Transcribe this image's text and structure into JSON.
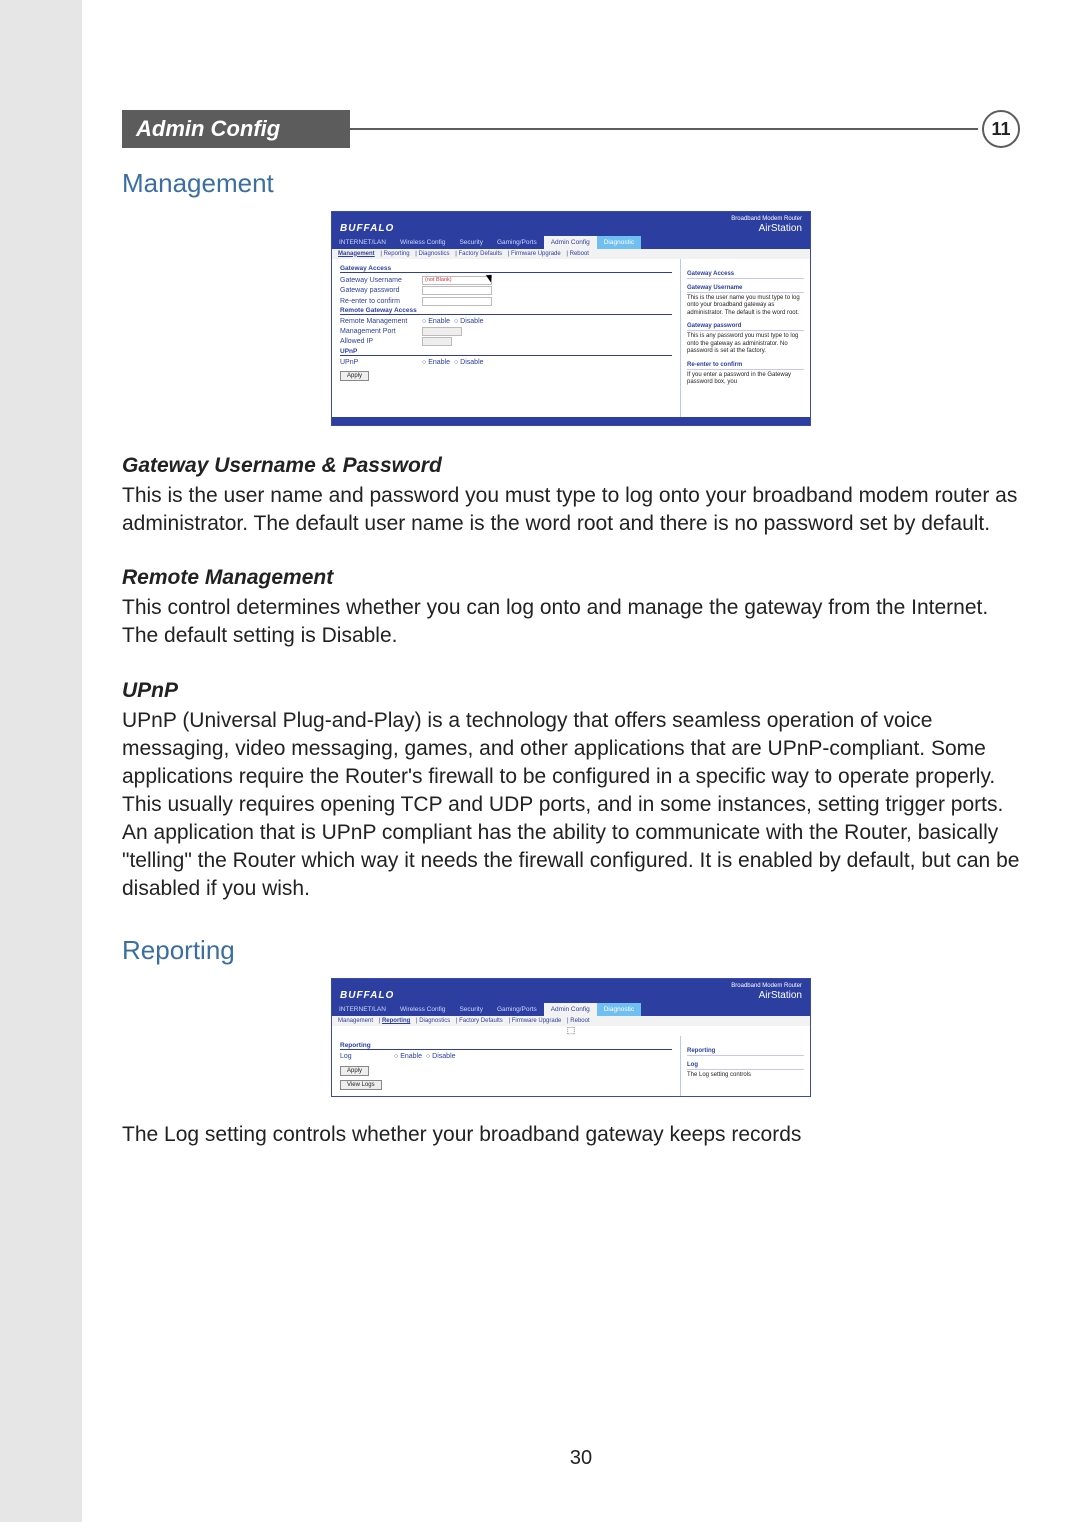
{
  "chapter": {
    "title": "Admin Config",
    "number": "11"
  },
  "sections": {
    "management": "Management",
    "reporting": "Reporting"
  },
  "gateway": {
    "heading": "Gateway Username & Password",
    "text": "This is the user name and password you must type to log onto your broadband modem router as administrator. The default user name is the word root and there is no password set by default."
  },
  "remote": {
    "heading": "Remote Management",
    "text": "This control determines whether you can log onto and manage the gateway from the Internet. The default setting is Disable."
  },
  "upnp": {
    "heading": "UPnP",
    "text": "UPnP (Universal Plug-and-Play) is a technology that offers seamless operation of voice messaging, video messaging, games, and other applications that are UPnP-compliant. Some applications require the Router's firewall to be configured in a specific way to operate properly. This usually requires opening TCP and UDP ports, and in some instances, setting trigger ports. An application that is UPnP compliant has the ability to communicate with the Router, basically \"telling\" the Router which way it needs the firewall configured. It is enabled by default, but can be disabled if you wish."
  },
  "reporting_text": "The Log setting controls whether your broadband gateway keeps records",
  "page_number": "30",
  "shot_common": {
    "brand": "BUFFALO",
    "tagline": "Broadband Modem Router",
    "airstation": "AirStation",
    "tabs": [
      "INTERNET/LAN",
      "Wireless Config",
      "Security",
      "Gaming/Ports",
      "Admin Config",
      "Diagnostic"
    ],
    "subtabs": [
      "Management",
      "Reporting",
      "Diagnostics",
      "Factory Defaults",
      "Firmware Upgrade",
      "Reboot"
    ]
  },
  "shot1": {
    "groups": {
      "gateway_access": "Gateway Access",
      "remote": "Remote Gateway Access",
      "upnp": "UPnP"
    },
    "fields": {
      "username_label": "Gateway Username",
      "username_value": "(not Blank)",
      "password_label": "Gateway password",
      "confirm_label": "Re-enter to confirm",
      "remote_label": "Remote Management",
      "port_label": "Management Port",
      "port_value": "",
      "allowed_label": "Allowed IP",
      "upnp_label": "UPnP",
      "enable": "Enable",
      "disable": "Disable",
      "apply": "Apply"
    },
    "help": {
      "h1": "Gateway Access",
      "h2": "Gateway Username",
      "p2": "This is the user name you must type to log onto your broadband gateway as administrator. The default is the word root.",
      "h3": "Gateway password",
      "p3": "This is any password you must type to log onto the gateway as administrator. No password is set at the factory.",
      "h4": "Re-enter to confirm",
      "p4": "If you enter a password in the Gateway password box, you"
    }
  },
  "shot2": {
    "group": "Reporting",
    "fields": {
      "log_label": "Log",
      "enable": "Enable",
      "disable": "Disable",
      "apply": "Apply",
      "view": "View Logs"
    },
    "help": {
      "h1": "Reporting",
      "h2": "Log",
      "p2": "The Log setting controls"
    }
  }
}
